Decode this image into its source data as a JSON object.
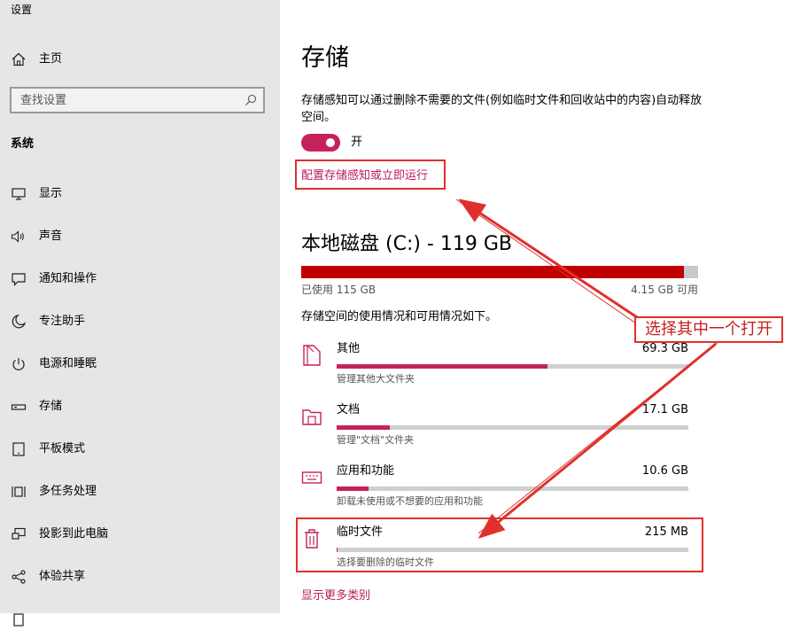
{
  "window": {
    "title": "设置"
  },
  "sidebar": {
    "home_label": "主页",
    "search_placeholder": "查找设置",
    "section_label": "系统",
    "items": [
      {
        "label": "显示",
        "icon": "monitor-icon"
      },
      {
        "label": "声音",
        "icon": "speaker-icon"
      },
      {
        "label": "通知和操作",
        "icon": "notification-icon"
      },
      {
        "label": "专注助手",
        "icon": "moon-icon"
      },
      {
        "label": "电源和睡眠",
        "icon": "power-icon"
      },
      {
        "label": "存储",
        "icon": "storage-icon"
      },
      {
        "label": "平板模式",
        "icon": "tablet-icon"
      },
      {
        "label": "多任务处理",
        "icon": "multitask-icon"
      },
      {
        "label": "投影到此电脑",
        "icon": "project-icon"
      },
      {
        "label": "体验共享",
        "icon": "share-icon"
      }
    ]
  },
  "main": {
    "title": "存储",
    "storage_sense": {
      "description": "存储感知可以通过删除不需要的文件(例如临时文件和回收站中的内容)自动释放空间。",
      "toggle_state": "开",
      "config_link": "配置存储感知或立即运行"
    },
    "disk": {
      "title": "本地磁盘 (C:) - 119 GB",
      "used_label": "已使用 115 GB",
      "free_label": "4.15 GB 可用",
      "used_fraction": 0.965,
      "usage_note": "存储空间的使用情况和可用情况如下。"
    },
    "categories": [
      {
        "name": "其他",
        "size": "69.3 GB",
        "desc": "管理其他大文件夹",
        "fraction": 0.6,
        "icon": "other-files-icon"
      },
      {
        "name": "文档",
        "size": "17.1 GB",
        "desc": "管理\"文档\"文件夹",
        "fraction": 0.15,
        "icon": "folder-icon"
      },
      {
        "name": "应用和功能",
        "size": "10.6 GB",
        "desc": "卸载未使用或不想要的应用和功能",
        "fraction": 0.09,
        "icon": "keyboard-icon"
      },
      {
        "name": "临时文件",
        "size": "215 MB",
        "desc": "选择要删除的临时文件",
        "fraction": 0.002,
        "icon": "trash-icon"
      }
    ],
    "more_link": "显示更多类别"
  },
  "annotation": {
    "callout_text": "选择其中一个打开",
    "color": "#e0302d"
  },
  "colors": {
    "accent": "#c4235a",
    "disk_used": "#c00000",
    "link": "#b8195a"
  }
}
